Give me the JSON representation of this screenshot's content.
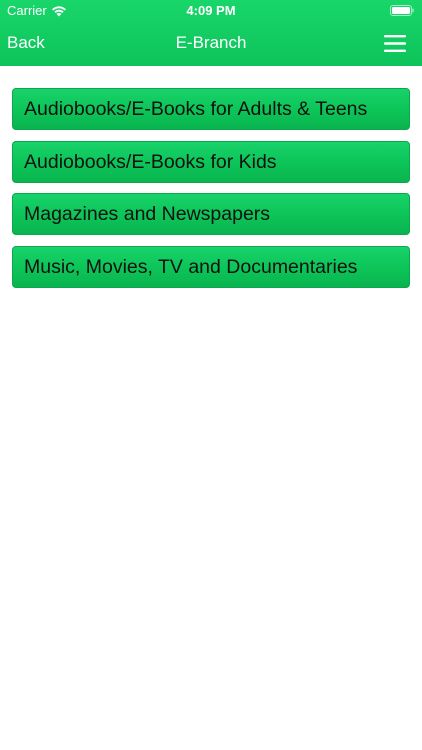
{
  "status_bar": {
    "carrier": "Carrier",
    "time": "4:09 PM"
  },
  "nav": {
    "back_label": "Back",
    "title": "E-Branch",
    "menu_icon": "hamburger-menu-icon"
  },
  "menu_items": [
    {
      "label": "Audiobooks/E-Books for Adults & Teens"
    },
    {
      "label": "Audiobooks/E-Books for Kids"
    },
    {
      "label": "Magazines and Newspapers"
    },
    {
      "label": "Music, Movies, TV and Documentaries"
    }
  ],
  "colors": {
    "header_green": "#12cd62",
    "button_green": "#0cc457",
    "button_text": "#111111",
    "background": "#ffffff"
  }
}
